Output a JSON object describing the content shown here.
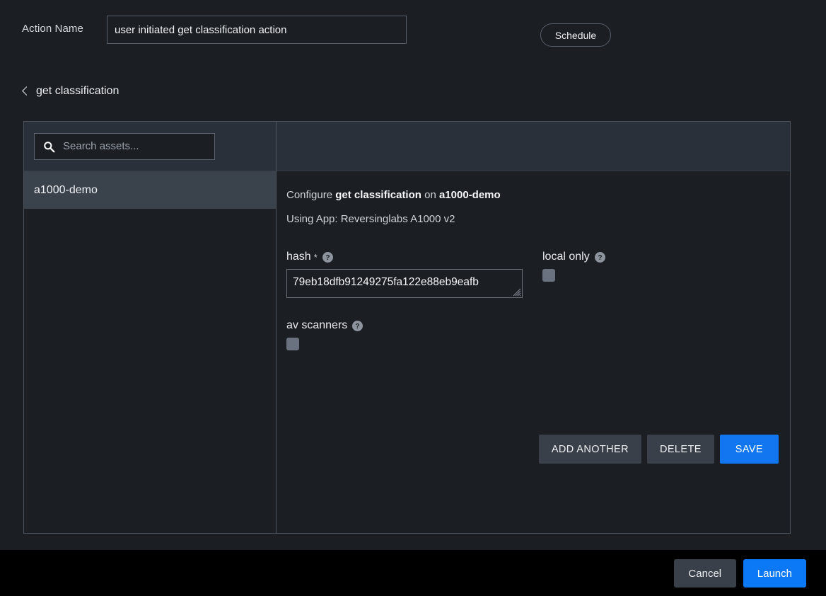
{
  "header": {
    "action_name_label": "Action Name",
    "action_name_value": "user initiated get classification action",
    "action_name_placeholder": "Action Name",
    "schedule_label": "Schedule"
  },
  "breadcrumb": {
    "back_icon": "chevron-left-icon",
    "label": "get classification"
  },
  "assets_panel": {
    "search_placeholder": "Search assets...",
    "search_value": "",
    "search_icon": "search-icon",
    "items": [
      {
        "label": "a1000-demo",
        "selected": true
      }
    ]
  },
  "config": {
    "prefix": "Configure",
    "action": "get classification",
    "conjunction": "on",
    "asset": "a1000-demo",
    "using_app": "Using App: Reversinglabs A1000 v2",
    "fields": [
      {
        "name": "hash",
        "label": "hash",
        "required": true,
        "required_marker": "*",
        "help_icon": "help-circle-icon",
        "type": "textarea",
        "value": "79eb18dfb91249275fa122e88eb9eafb"
      },
      {
        "name": "local only",
        "label": "local only",
        "required": false,
        "help_icon": "help-circle-icon",
        "type": "checkbox",
        "checked": false
      },
      {
        "name": "av scanners",
        "label": "av scanners",
        "required": false,
        "help_icon": "help-circle-icon",
        "type": "checkbox",
        "checked": false
      }
    ],
    "buttons": {
      "add_another": "ADD ANOTHER",
      "delete": "DELETE",
      "save": "SAVE"
    }
  },
  "footer": {
    "cancel_label": "Cancel",
    "launch_label": "Launch"
  },
  "colors": {
    "background": "#1b1f24",
    "panel_header": "#2a303a",
    "selected_row": "#3a424c",
    "accent_blue": "#0b79f5",
    "button_grey": "#3a4049",
    "border": "#4a525c",
    "footer_bar": "#000000"
  }
}
